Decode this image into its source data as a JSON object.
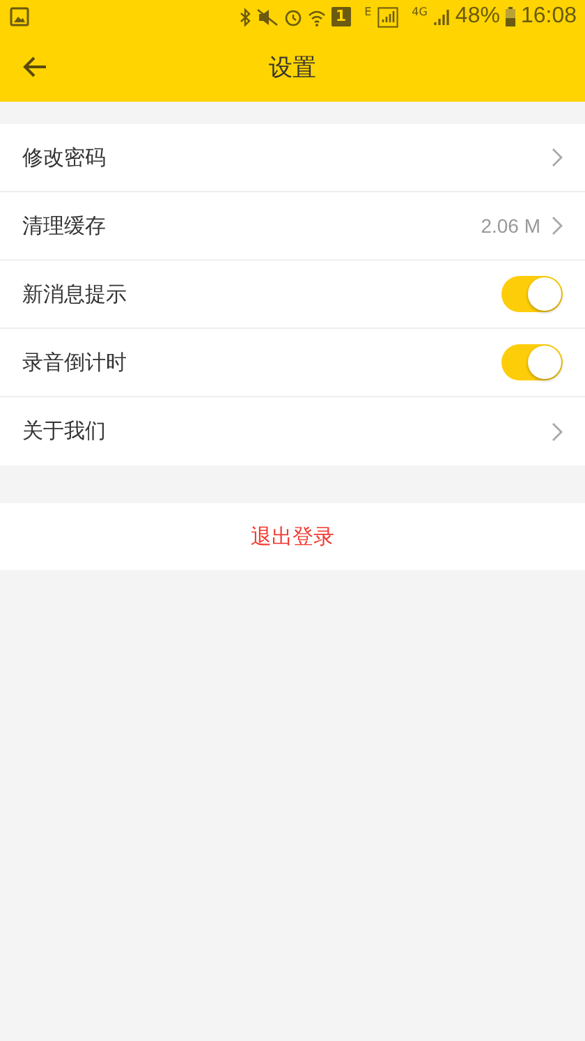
{
  "status_bar": {
    "sim": "1",
    "network_1": "E",
    "network_2": "4G",
    "battery": "48%",
    "time": "16:08"
  },
  "header": {
    "title": "设置"
  },
  "rows": [
    {
      "kind": "link",
      "label": "修改密码"
    },
    {
      "kind": "link",
      "label": "清理缓存",
      "value": "2.06 M"
    },
    {
      "kind": "toggle",
      "label": "新消息提示",
      "on": true
    },
    {
      "kind": "toggle",
      "label": "录音倒计时",
      "on": true
    },
    {
      "kind": "link",
      "label": "关于我们"
    }
  ],
  "logout": {
    "label": "退出登录"
  }
}
